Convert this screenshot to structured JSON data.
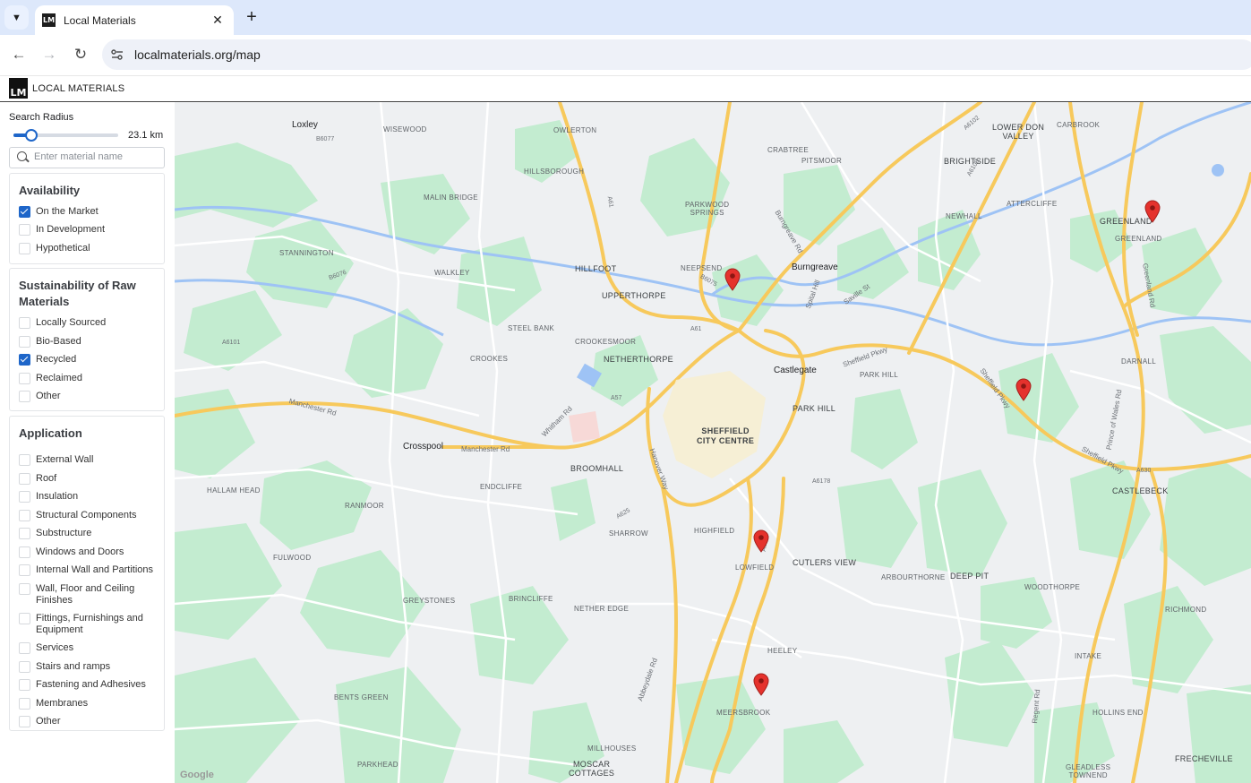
{
  "browser": {
    "tab_title": "Local Materials",
    "tab_favicon_text": "LM",
    "url": "localmaterials.org/map"
  },
  "app": {
    "logo_text": "LM",
    "name": "LOCAL MATERIALS"
  },
  "sidebar": {
    "radius_label": "Search Radius",
    "radius_value": "23.1 km",
    "radius_fraction": 0.15,
    "search_placeholder": "Enter material name",
    "availability": {
      "title": "Availability",
      "options": [
        {
          "label": "On the Market",
          "checked": true
        },
        {
          "label": "In Development",
          "checked": false
        },
        {
          "label": "Hypothetical",
          "checked": false
        }
      ]
    },
    "sustainability": {
      "title": "Sustainability of Raw Materials",
      "options": [
        {
          "label": "Locally Sourced",
          "checked": false
        },
        {
          "label": "Bio-Based",
          "checked": false
        },
        {
          "label": "Recycled",
          "checked": true
        },
        {
          "label": "Reclaimed",
          "checked": false
        },
        {
          "label": "Other",
          "checked": false
        }
      ]
    },
    "application": {
      "title": "Application",
      "options": [
        {
          "label": "External Wall",
          "checked": false
        },
        {
          "label": "Roof",
          "checked": false
        },
        {
          "label": "Insulation",
          "checked": false
        },
        {
          "label": "Structural Components",
          "checked": false
        },
        {
          "label": "Substructure",
          "checked": false
        },
        {
          "label": "Windows and Doors",
          "checked": false
        },
        {
          "label": "Internal Wall and Partitions",
          "checked": false
        },
        {
          "label": "Wall, Floor and Ceiling Finishes",
          "checked": false
        },
        {
          "label": "Fittings, Furnishings and Equipment",
          "checked": false
        },
        {
          "label": "Services",
          "checked": false
        },
        {
          "label": "Stairs and ramps",
          "checked": false
        },
        {
          "label": "Fastening and Adhesives",
          "checked": false
        },
        {
          "label": "Membranes",
          "checked": false
        },
        {
          "label": "Other",
          "checked": false
        }
      ]
    }
  },
  "map": {
    "colors": {
      "water": "#9ec3f5",
      "park": "#c3ecd0",
      "major_road": "#f7c95c",
      "marker": "#e5322d"
    },
    "places": {
      "loxley": "Loxley",
      "wisewood": "WISEWOOD",
      "owlerton": "OWLERTON",
      "lower_don_valley": "LOWER DON\nVALLEY",
      "carbrook": "CARBROOK",
      "crabtree": "CRABTREE",
      "pitsmoor": "PITSMOOR",
      "brightside": "BRIGHTSIDE",
      "hillsborough": "HILLSBOROUGH",
      "malin_bridge": "MALIN BRIDGE",
      "parkwood_springs": "PARKWOOD\nSPRINGS",
      "attercliffe": "ATTERCLIFFE",
      "newhall": "NEWHALL",
      "greenland": "GREENLAND",
      "greenland2": "GREENLAND",
      "stannington": "STANNINGTON",
      "walkley": "WALKLEY",
      "hillfoot": "HILLFOOT",
      "neepsend": "NEEPSEND",
      "burngreave": "Burngreave",
      "upperthorpe": "UPPERTHORPE",
      "steel_bank": "STEEL BANK",
      "crookesmoor": "CROOKESMOOR",
      "netherthorpe": "NETHERTHORPE",
      "crookes": "CROOKES",
      "castlegate": "Castlegate",
      "park_hill_n": "PARK HILL",
      "darnall": "DARNALL",
      "park_hill": "PARK HILL",
      "sheffield_city_centre": "SHEFFIELD\nCITY CENTRE",
      "crosspool": "Crosspool",
      "broomhall": "BROOMHALL",
      "endcliffe": "ENDCLIFFE",
      "hallam_head": "HALLAM HEAD",
      "ranmoor": "RANMOOR",
      "castlebeck": "CASTLEBECK",
      "sharrow": "SHARROW",
      "highfield": "HIGHFIELD",
      "fulwood": "FULWOOD",
      "lowfield": "LOWFIELD",
      "cutlers_view": "CUTLERS VIEW",
      "arbourthorne": "ARBOURTHORNE",
      "deep_pit": "DEEP PIT",
      "greystones": "GREYSTONES",
      "brincliffe": "BRINCLIFFE",
      "nether_edge": "NETHER EDGE",
      "woodthorpe": "WOODTHORPE",
      "richmond": "RICHMOND",
      "heeley": "HEELEY",
      "intake": "INTAKE",
      "bents_green": "BENTS GREEN",
      "meersbrook": "MEERSBROOK",
      "hollins_end": "HOLLINS END",
      "millhouses": "MILLHOUSES",
      "moscar_cottages": "MOSCAR\nCOTTAGES",
      "parkhead": "PARKHEAD",
      "gleadless_townend": "GLEADLESS\nTOWNEND",
      "frecheville": "FRECHEVILLE"
    },
    "roads": {
      "b6077": "B6077",
      "a6109": "A6109",
      "a6102": "A6102",
      "a61_n": "A61",
      "a61_c": "A61",
      "a61_s": "A61",
      "a57": "A57",
      "a625": "A625",
      "a6178": "A6178",
      "a630": "A630",
      "b6075": "B6075",
      "b6076": "B6076",
      "a6101": "A6101",
      "manchester_rd": "Manchester Rd",
      "manchester_rd2": "Manchester Rd",
      "whitham_rd": "Whitham Rd",
      "sheffield_pkwy": "Sheffield Pkwy",
      "sheffield_pkwy2": "Sheffield Pkwy",
      "sheffield_pkwy3": "Sheffield Pkwy",
      "abbeydale_rd": "Abbeydale Rd",
      "prince_of_wales_rd": "Prince of Wales Rd",
      "spital_hill": "Spital Hill",
      "burngreave_rd": "Burngreave Rd",
      "hanover_way": "Hanover Way",
      "greenland_rd": "Greenland Rd",
      "regent_rd": "Regent Rd",
      "saville_st": "Saville St"
    },
    "attribution": "Google",
    "markers": [
      {
        "name": "neepsend"
      },
      {
        "name": "greenland"
      },
      {
        "name": "darnall"
      },
      {
        "name": "lowfield"
      },
      {
        "name": "meersbrook"
      }
    ]
  }
}
